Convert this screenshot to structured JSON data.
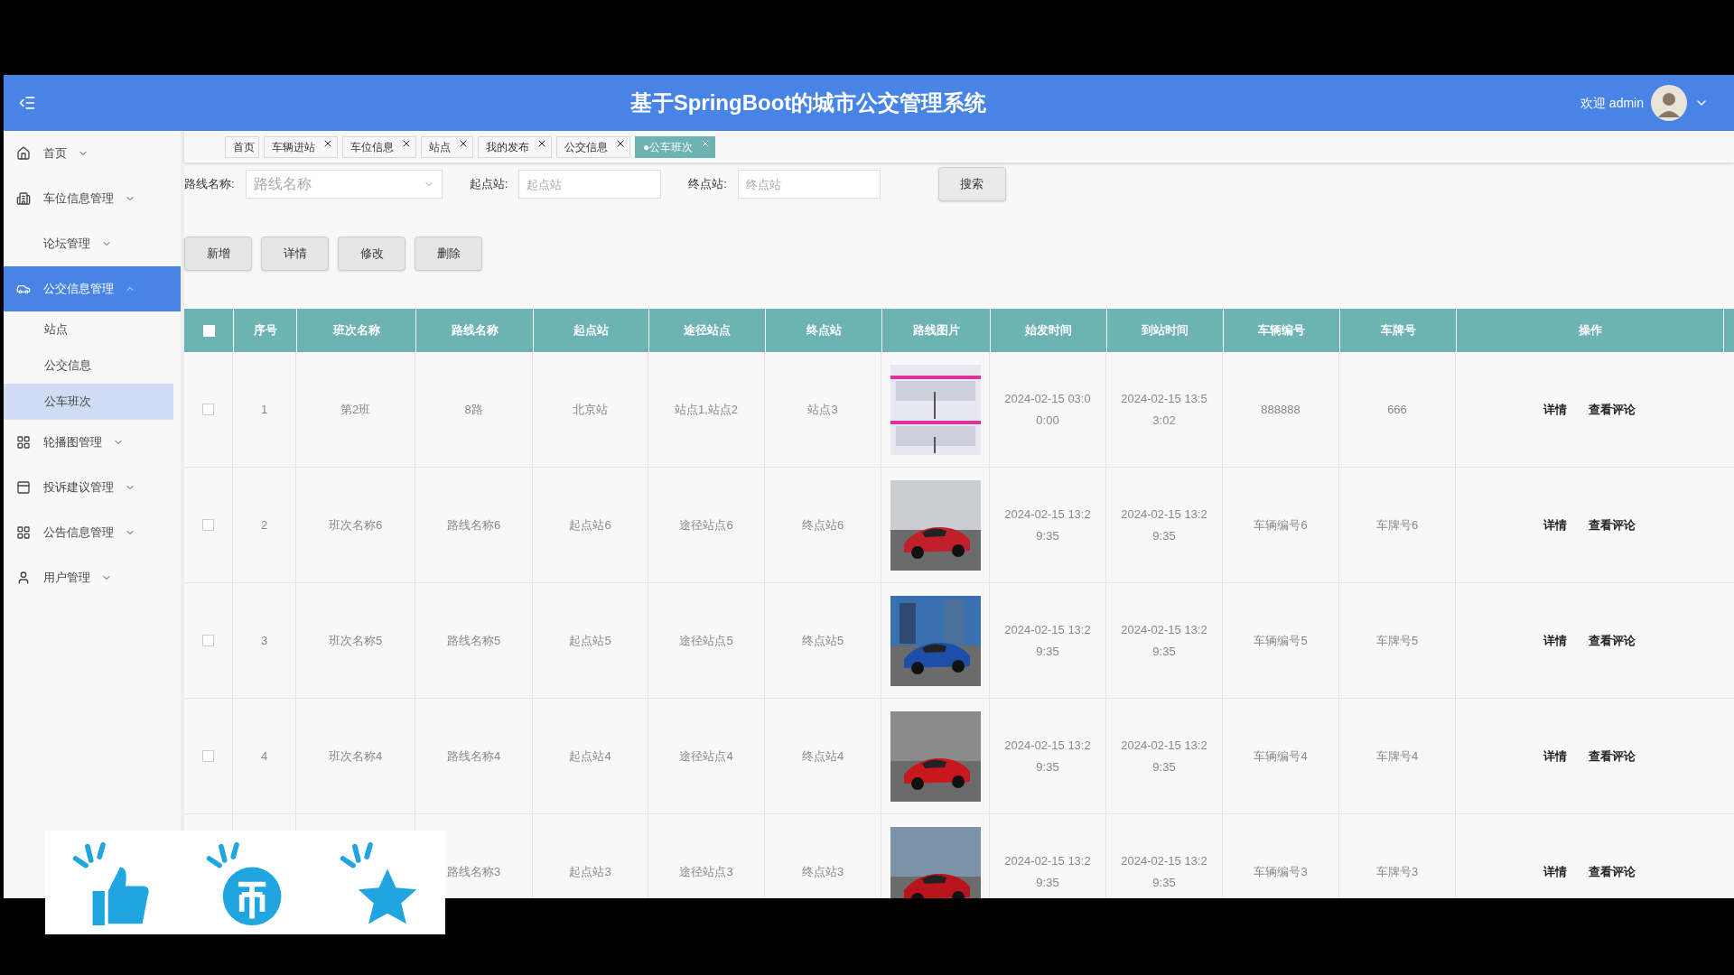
{
  "header": {
    "title": "基于SpringBoot的城市公交管理系统",
    "welcome": "欢迎 admin"
  },
  "sidebar": {
    "items": [
      {
        "label": "首页",
        "expanded": false,
        "selected": false
      },
      {
        "label": "车位信息管理",
        "expanded": false,
        "selected": false
      },
      {
        "label": "论坛管理",
        "expanded": false,
        "selected": false
      },
      {
        "label": "公交信息管理",
        "expanded": true,
        "selected": true,
        "children": [
          {
            "label": "站点",
            "selected": false
          },
          {
            "label": "公交信息",
            "selected": false
          },
          {
            "label": "公车班次",
            "selected": true
          }
        ]
      },
      {
        "label": "轮播图管理",
        "expanded": false,
        "selected": false
      },
      {
        "label": "投诉建议管理",
        "expanded": false,
        "selected": false
      },
      {
        "label": "公告信息管理",
        "expanded": false,
        "selected": false
      },
      {
        "label": "用户管理",
        "expanded": false,
        "selected": false
      }
    ]
  },
  "tabs": [
    {
      "label": "首页",
      "closable": false,
      "selected": false
    },
    {
      "label": "车辆进站",
      "closable": true,
      "selected": false
    },
    {
      "label": "车位信息",
      "closable": true,
      "selected": false
    },
    {
      "label": "站点",
      "closable": true,
      "selected": false
    },
    {
      "label": "我的发布",
      "closable": true,
      "selected": false
    },
    {
      "label": "公交信息",
      "closable": true,
      "selected": false
    },
    {
      "label": "●公车班次",
      "closable": true,
      "selected": true
    }
  ],
  "search": {
    "fields": [
      {
        "label": "路线名称:",
        "placeholder": "路线名称",
        "kind": "select"
      },
      {
        "label": "起点站:",
        "placeholder": "起点站",
        "kind": "input"
      },
      {
        "label": "终点站:",
        "placeholder": "终点站",
        "kind": "input"
      }
    ],
    "button": "搜索"
  },
  "actions": [
    "新增",
    "详情",
    "修改",
    "删除"
  ],
  "table": {
    "select_all": {
      "checked": false
    },
    "columns": [
      "序号",
      "班次名称",
      "路线名称",
      "起点站",
      "途径站点",
      "终点站",
      "路线图片",
      "始发时间",
      "到站时间",
      "车辆编号",
      "车牌号",
      "操作"
    ],
    "rows": [
      {
        "checked": false,
        "cells": [
          "1",
          "第2班",
          "8路",
          "北京站",
          "站点1,站点2",
          "站点3",
          "",
          "2024-02-15 03:0\n0:00",
          "2024-02-15 13:5\n3:02",
          "888888",
          "666"
        ],
        "actions": [
          "详情",
          "查看评论"
        ]
      },
      {
        "checked": false,
        "cells": [
          "2",
          "班次名称6",
          "路线名称6",
          "起点站6",
          "途径站点6",
          "终点站6",
          "",
          "2024-02-15 13:2\n9:35",
          "2024-02-15 13:2\n9:35",
          "车辆编号6",
          "车牌号6"
        ],
        "actions": [
          "详情",
          "查看评论"
        ]
      },
      {
        "checked": false,
        "cells": [
          "3",
          "班次名称5",
          "路线名称5",
          "起点站5",
          "途径站点5",
          "终点站5",
          "",
          "2024-02-15 13:2\n9:35",
          "2024-02-15 13:2\n9:35",
          "车辆编号5",
          "车牌号5"
        ],
        "actions": [
          "详情",
          "查看评论"
        ]
      },
      {
        "checked": false,
        "cells": [
          "4",
          "班次名称4",
          "路线名称4",
          "起点站4",
          "途径站点4",
          "终点站4",
          "",
          "2024-02-15 13:2\n9:35",
          "2024-02-15 13:2\n9:35",
          "车辆编号4",
          "车牌号4"
        ],
        "actions": [
          "详情",
          "查看评论"
        ]
      },
      {
        "cells": [
          "",
          "",
          "路线名称3",
          "起点站3",
          "途径站点3",
          "终点站3",
          "",
          "2024-02-15 13:2\n9:35",
          "2024-02-15 13:2\n9:35",
          "车辆编号3",
          "车牌号3"
        ],
        "actions": [
          "详情",
          "查看评论"
        ]
      }
    ]
  }
}
